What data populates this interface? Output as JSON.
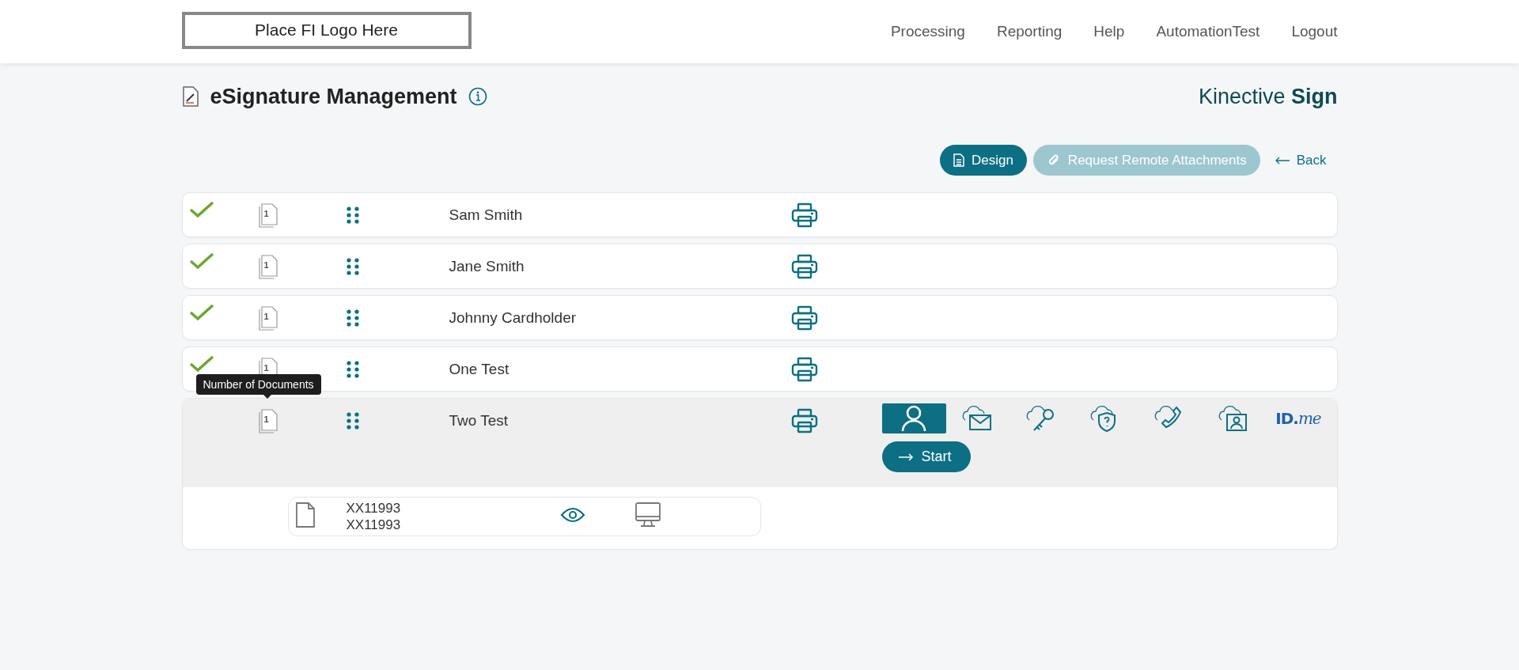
{
  "header": {
    "logo": "Place FI Logo Here",
    "nav": [
      "Processing",
      "Reporting",
      "Help",
      "AutomationTest",
      "Logout"
    ]
  },
  "page": {
    "title": "eSignature Management",
    "brand": "Kinective **Sign**"
  },
  "actions": [
    {
      "kind": "design",
      "label": "Design",
      "disabled": false
    },
    {
      "kind": "attach",
      "label": "Request Remote Attachments",
      "disabled": true
    }
  ],
  "back": {
    "label": "Back"
  },
  "signers": [
    {
      "name": "Sam Smith",
      "signed": true,
      "document_count": "1",
      "expanded": false
    },
    {
      "name": "Jane Smith",
      "signed": true,
      "document_count": "1",
      "expanded": false
    },
    {
      "name": "Johnny Cardholder",
      "signed": true,
      "document_count": "1",
      "expanded": false
    },
    {
      "name": "One Test",
      "signed": true,
      "document_count": "1",
      "expanded": false
    },
    {
      "name": "Two Test",
      "signed": false,
      "document_count": "1",
      "expanded": true,
      "tooltip": "Number of Documents",
      "auth_methods": [
        {
          "kind": "person",
          "selected": true
        },
        {
          "kind": "cloud-mail",
          "selected": false
        },
        {
          "kind": "cloud-key",
          "selected": false
        },
        {
          "kind": "cloud-shield",
          "selected": false
        },
        {
          "kind": "cloud-phone",
          "selected": false
        },
        {
          "kind": "cloud-id",
          "selected": false
        },
        {
          "kind": "idme",
          "label": "ID.*me*",
          "selected": false
        }
      ],
      "start": "Start",
      "documents": [
        {
          "title": "XX11993",
          "subtitle": "XX11993"
        }
      ]
    }
  ]
}
